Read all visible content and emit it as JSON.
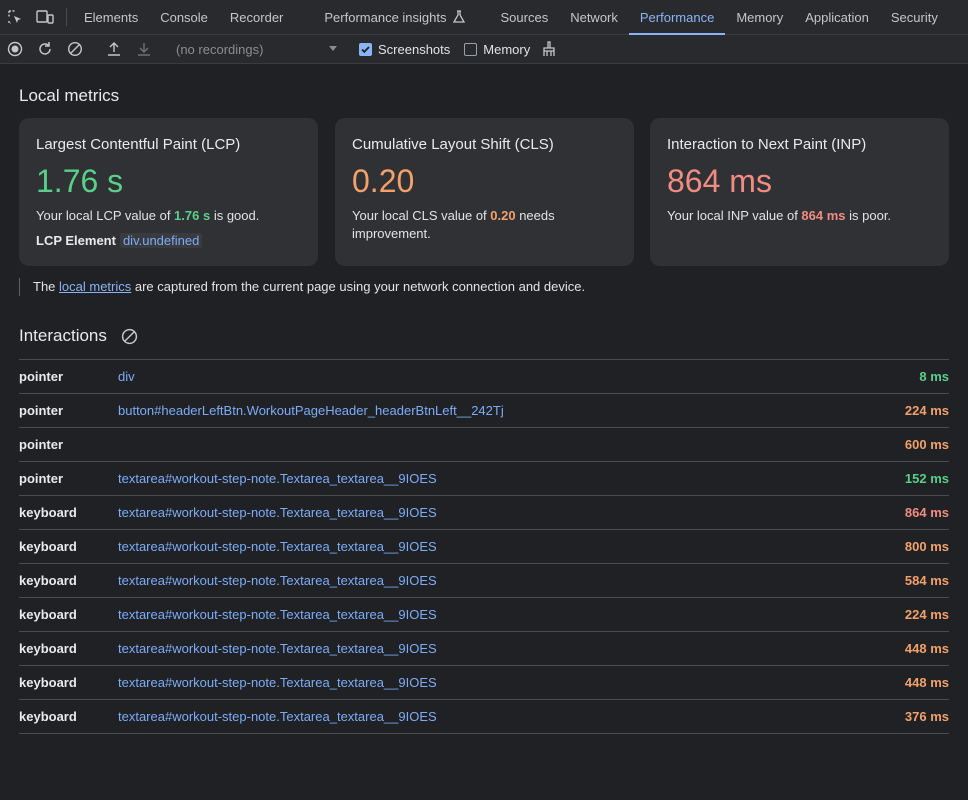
{
  "tabs": [
    {
      "label": "Elements"
    },
    {
      "label": "Console"
    },
    {
      "label": "Recorder"
    },
    {
      "label": "Performance insights"
    },
    {
      "label": "Sources"
    },
    {
      "label": "Network"
    },
    {
      "label": "Performance",
      "active": true
    },
    {
      "label": "Memory"
    },
    {
      "label": "Application"
    },
    {
      "label": "Security"
    }
  ],
  "toolbar": {
    "recordings_placeholder": "(no recordings)",
    "screenshots_label": "Screenshots",
    "screenshots_checked": true,
    "memory_label": "Memory",
    "memory_checked": false
  },
  "local_metrics": {
    "heading": "Local metrics",
    "lcp": {
      "title": "Largest Contentful Paint (LCP)",
      "value": "1.76 s",
      "desc_before": "Your local LCP value of ",
      "desc_value": "1.76 s",
      "desc_after": " is good.",
      "element_label": "LCP Element",
      "element_value": "div.undefined"
    },
    "cls": {
      "title": "Cumulative Layout Shift (CLS)",
      "value": "0.20",
      "desc_before": "Your local CLS value of ",
      "desc_value": "0.20",
      "desc_after": " needs improvement."
    },
    "inp": {
      "title": "Interaction to Next Paint (INP)",
      "value": "864 ms",
      "desc_before": "Your local INP value of ",
      "desc_value": "864 ms",
      "desc_after": " is poor."
    },
    "note_before": "The ",
    "note_link": "local metrics",
    "note_after": " are captured from the current page using your network connection and device."
  },
  "interactions": {
    "heading": "Interactions",
    "rows": [
      {
        "type": "pointer",
        "target": "div",
        "duration": "8 ms",
        "rating": "good"
      },
      {
        "type": "pointer",
        "target": "button#headerLeftBtn.WorkoutPageHeader_headerBtnLeft__242Tj",
        "duration": "224 ms",
        "rating": "ni"
      },
      {
        "type": "pointer",
        "target": "",
        "duration": "600 ms",
        "rating": "ni"
      },
      {
        "type": "pointer",
        "target": "textarea#workout-step-note.Textarea_textarea__9IOES",
        "duration": "152 ms",
        "rating": "good"
      },
      {
        "type": "keyboard",
        "target": "textarea#workout-step-note.Textarea_textarea__9IOES",
        "duration": "864 ms",
        "rating": "poor"
      },
      {
        "type": "keyboard",
        "target": "textarea#workout-step-note.Textarea_textarea__9IOES",
        "duration": "800 ms",
        "rating": "ni"
      },
      {
        "type": "keyboard",
        "target": "textarea#workout-step-note.Textarea_textarea__9IOES",
        "duration": "584 ms",
        "rating": "ni"
      },
      {
        "type": "keyboard",
        "target": "textarea#workout-step-note.Textarea_textarea__9IOES",
        "duration": "224 ms",
        "rating": "ni"
      },
      {
        "type": "keyboard",
        "target": "textarea#workout-step-note.Textarea_textarea__9IOES",
        "duration": "448 ms",
        "rating": "ni"
      },
      {
        "type": "keyboard",
        "target": "textarea#workout-step-note.Textarea_textarea__9IOES",
        "duration": "448 ms",
        "rating": "ni"
      },
      {
        "type": "keyboard",
        "target": "textarea#workout-step-note.Textarea_textarea__9IOES",
        "duration": "376 ms",
        "rating": "ni"
      }
    ]
  },
  "colors": {
    "good": "#58d089",
    "needs_improvement": "#f3a06b",
    "poor": "#f28b82",
    "accent": "#8ab4f8"
  }
}
